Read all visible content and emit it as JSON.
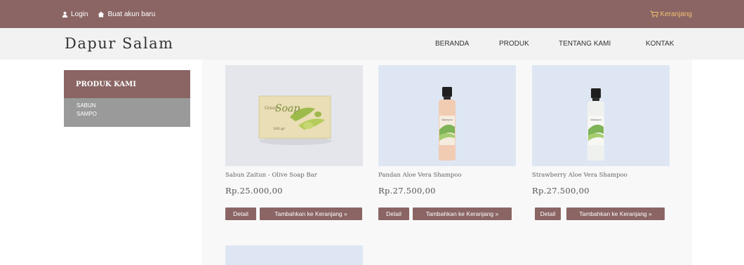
{
  "topbar": {
    "login_label": "Login",
    "register_label": "Buat akun baru",
    "cart_label": "Keranjang"
  },
  "header": {
    "brand": "Dapur Salam",
    "nav": [
      "BERANDA",
      "PRODUK",
      "TENTANG KAMI",
      "KONTAK"
    ]
  },
  "sidebar": {
    "title": "PRODUK KAMI",
    "categories": [
      "SABUN",
      "SAMPO"
    ]
  },
  "products": [
    {
      "name": "Sabun Zaitun - Olive Soap Bar",
      "price": "Rp.25.000,00",
      "detail_label": "Detail",
      "add_label": "Tambahkan ke Keranjang »"
    },
    {
      "name": "Pandan Aloe Vera Shampoo",
      "price": "Rp.27.500,00",
      "detail_label": "Detail",
      "add_label": "Tambahkan ke Keranjang »"
    },
    {
      "name": "Strawberry Aloe Vera Shampoo",
      "price": "Rp.27.500,00",
      "detail_label": "Detail",
      "add_label": "Tambahkan ke Keranjang »"
    }
  ],
  "product_images": {
    "soap_label": "Soap",
    "soap_weight": "100 gr"
  },
  "colors": {
    "brand": "#8a6564",
    "sidebar_body": "#9a9a9a",
    "cart_text": "#f0c070",
    "image_bg": "#dfe6f3"
  }
}
